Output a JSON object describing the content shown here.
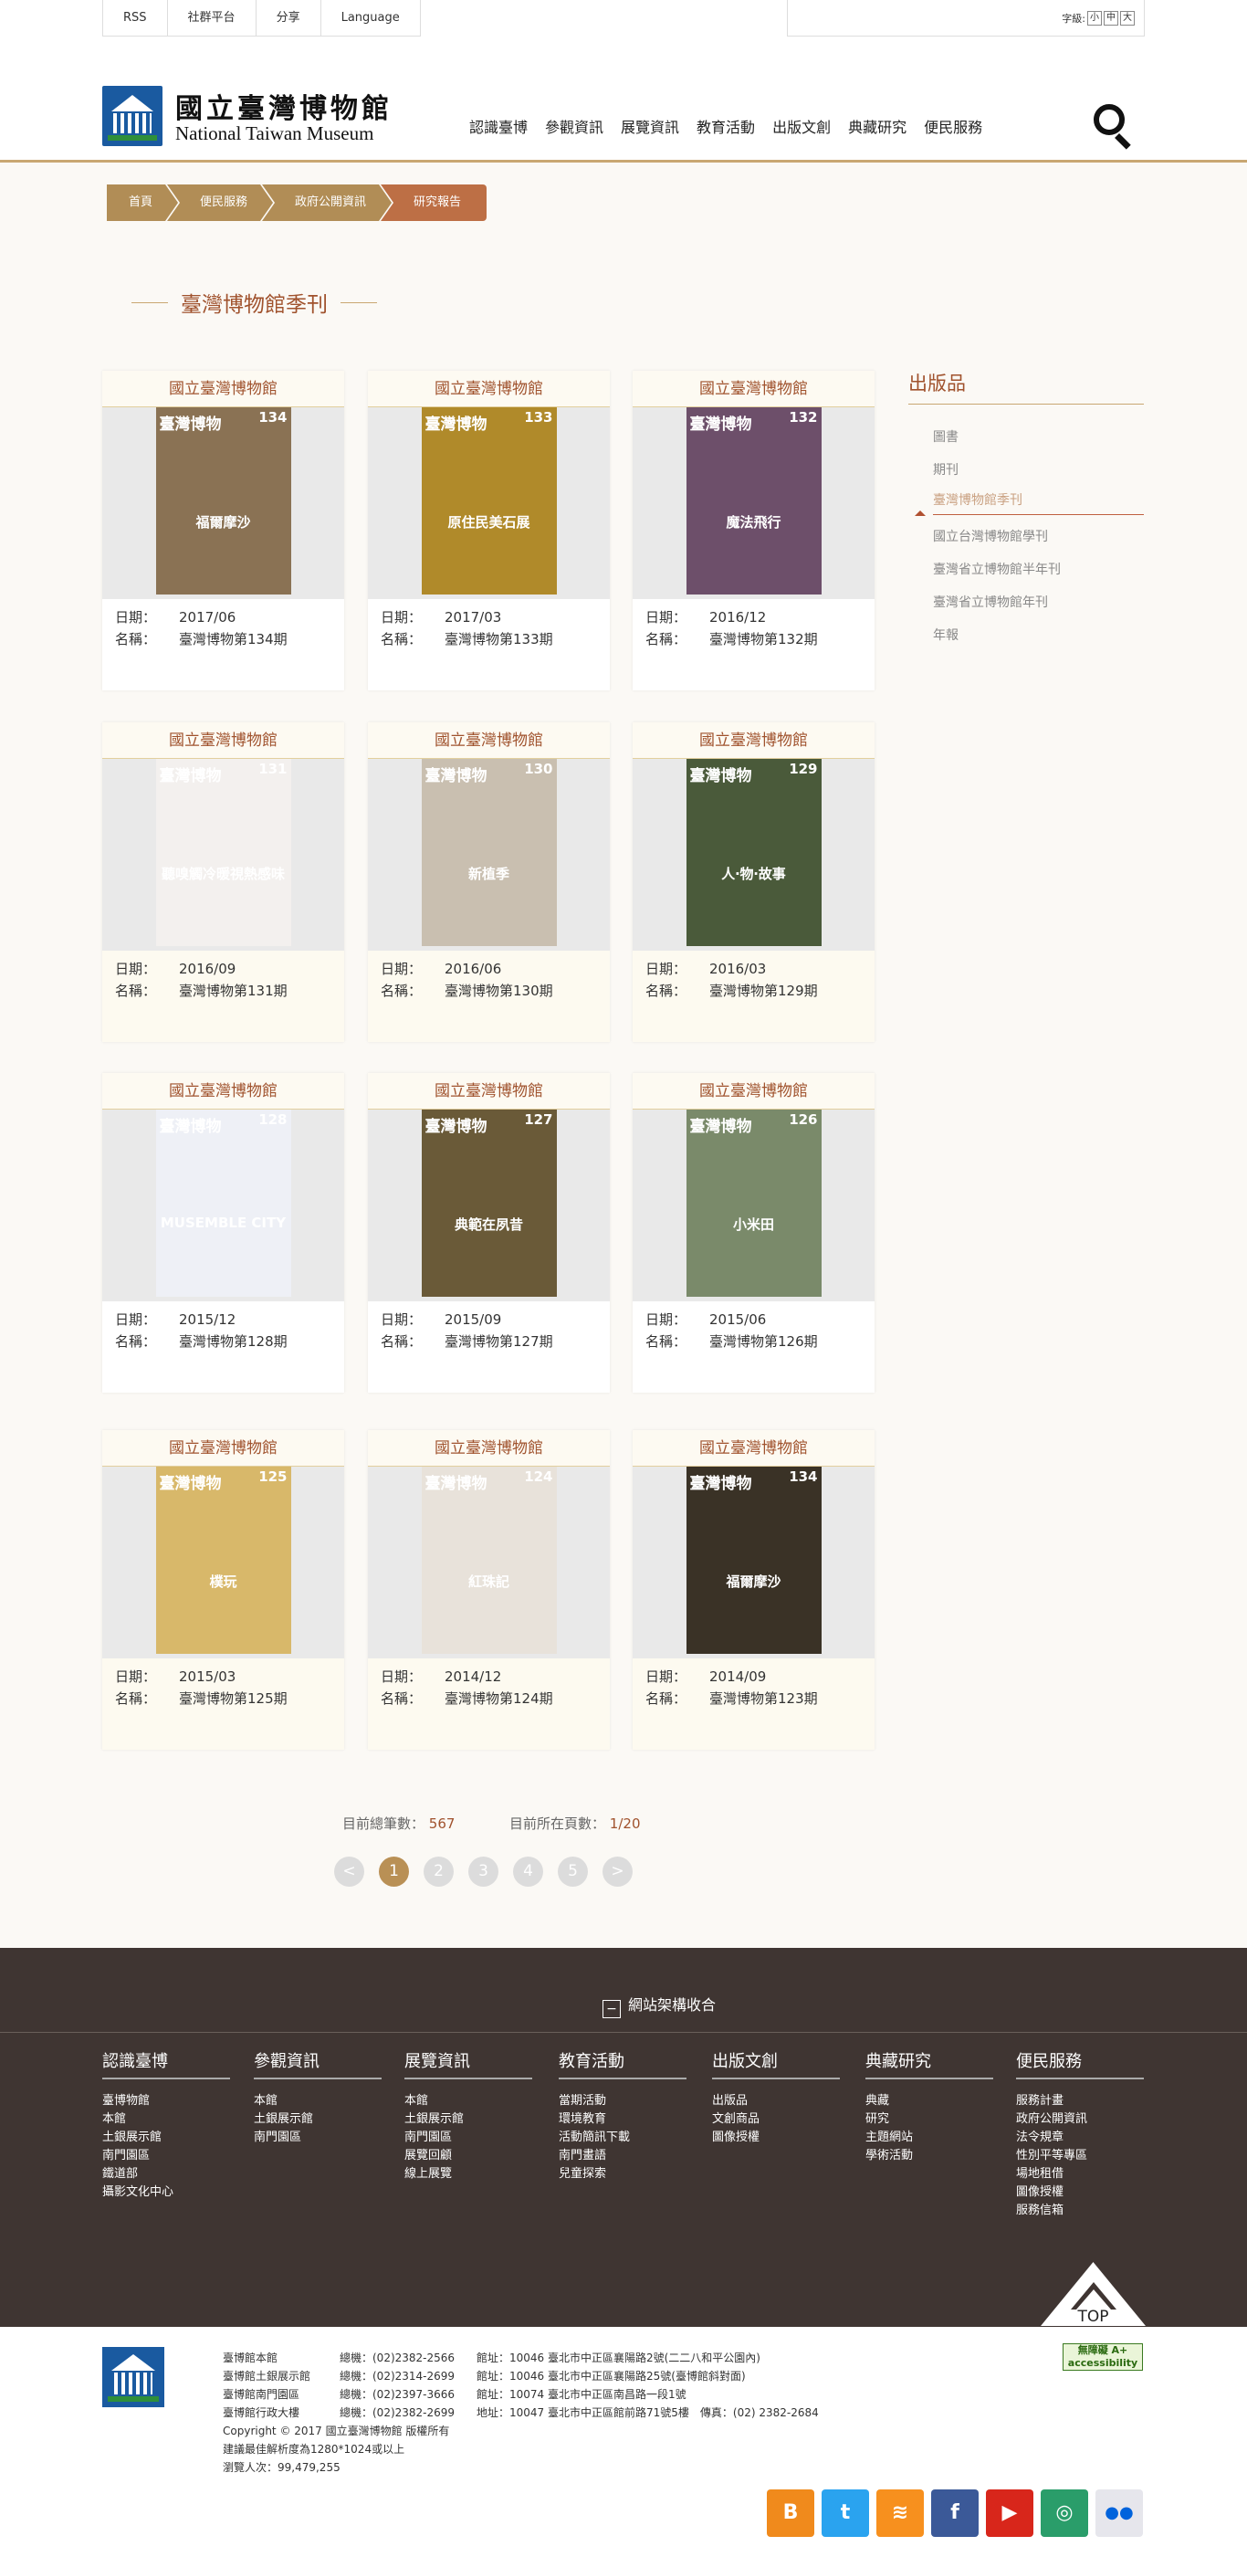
{
  "topbar": {
    "links": [
      "RSS",
      "社群平台",
      "分享",
      "Language"
    ],
    "fontsize_label": "字級:",
    "sizes": [
      "小",
      "中",
      "大"
    ]
  },
  "logo": {
    "zh": "國立臺灣博物館",
    "en": "National Taiwan Museum"
  },
  "nav": [
    "認識臺博",
    "參觀資訊",
    "展覽資訊",
    "教育活動",
    "出版文創",
    "典藏研究",
    "便民服務"
  ],
  "breadcrumb": [
    "首頁",
    "便民服務",
    "政府公開資訊",
    "研究報告"
  ],
  "page_title": "臺灣博物館季刊",
  "cards": [
    {
      "title": "國立臺灣博物館",
      "no": "134",
      "date": "2017/06",
      "name": "臺灣博物第134期",
      "bg": "#8a7254",
      "sub": "福爾摩沙"
    },
    {
      "title": "國立臺灣博物館",
      "no": "133",
      "date": "2017/03",
      "name": "臺灣博物第133期",
      "bg": "#b08a2a",
      "sub": "原住民美石展"
    },
    {
      "title": "國立臺灣博物館",
      "no": "132",
      "date": "2016/12",
      "name": "臺灣博物第132期",
      "bg": "#6d4f6a",
      "sub": "魔法飛行"
    },
    {
      "title": "國立臺灣博物館",
      "no": "131",
      "date": "2016/09",
      "name": "臺灣博物第131期",
      "bg": "#f3f0ee",
      "sub": "聽嗅觸冷暖視熱感味"
    },
    {
      "title": "國立臺灣博物館",
      "no": "130",
      "date": "2016/06",
      "name": "臺灣博物第130期",
      "bg": "#c9bfb0",
      "sub": "新植季"
    },
    {
      "title": "國立臺灣博物館",
      "no": "129",
      "date": "2016/03",
      "name": "臺灣博物第129期",
      "bg": "#4a5a3a",
      "sub": "人‧物‧故事"
    },
    {
      "title": "國立臺灣博物館",
      "no": "128",
      "date": "2015/12",
      "name": "臺灣博物第128期",
      "bg": "#eef0f6",
      "sub": "MUSEMBLE CITY"
    },
    {
      "title": "國立臺灣博物館",
      "no": "127",
      "date": "2015/09",
      "name": "臺灣博物第127期",
      "bg": "#6a5a38",
      "sub": "典範在夙昔"
    },
    {
      "title": "國立臺灣博物館",
      "no": "126",
      "date": "2015/06",
      "name": "臺灣博物第126期",
      "bg": "#7a8a6a",
      "sub": "小米田"
    },
    {
      "title": "國立臺灣博物館",
      "no": "125",
      "date": "2015/03",
      "name": "臺灣博物第125期",
      "bg": "#d8b86a",
      "sub": "樸玩"
    },
    {
      "title": "國立臺灣博物館",
      "no": "124",
      "date": "2014/12",
      "name": "臺灣博物第124期",
      "bg": "#e8e2da",
      "sub": "紅珠記"
    },
    {
      "title": "國立臺灣博物館",
      "no": "134",
      "date": "2014/09",
      "name": "臺灣博物第123期",
      "bg": "#3a3226",
      "sub": "福爾摩沙"
    }
  ],
  "meta_labels": {
    "date": "日期：",
    "name": "名稱："
  },
  "sidebar": {
    "title": "出版品",
    "items": [
      "圖書",
      "期刊",
      "臺灣博物館季刊",
      "國立台灣博物館學刊",
      "臺灣省立博物館半年刊",
      "臺灣省立博物館年刊",
      "年報"
    ]
  },
  "stats": {
    "total_label": "目前總筆數：",
    "total": "567",
    "page_label": "目前所在頁數：",
    "page": "1/20"
  },
  "pager": [
    "<",
    "1",
    "2",
    "3",
    "4",
    "5",
    ">"
  ],
  "footer": {
    "toggle": "網站架構收合",
    "columns": [
      {
        "title": "認識臺博",
        "items": [
          "臺博物館",
          "本館",
          "土銀展示館",
          "南門園區",
          "鐵道部",
          "攝影文化中心"
        ]
      },
      {
        "title": "參觀資訊",
        "items": [
          "本館",
          "土銀展示館",
          "南門園區"
        ]
      },
      {
        "title": "展覽資訊",
        "items": [
          "本館",
          "土銀展示館",
          "南門園區",
          "展覽回顧",
          "線上展覽"
        ]
      },
      {
        "title": "教育活動",
        "items": [
          "當期活動",
          "環境教育",
          "活動簡訊下載",
          "南門畫語",
          "兒童探索"
        ]
      },
      {
        "title": "出版文創",
        "items": [
          "出版品",
          "文創商品",
          "圖像授權"
        ]
      },
      {
        "title": "典藏研究",
        "items": [
          "典藏",
          "研究",
          "主題網站",
          "學術活動"
        ]
      },
      {
        "title": "便民服務",
        "items": [
          "服務計畫",
          "政府公開資訊",
          "法令規章",
          "性別平等專區",
          "場地租借",
          "圖像授權",
          "服務信箱"
        ]
      }
    ],
    "top": "TOP"
  },
  "bottom": {
    "rows": [
      [
        "臺博館本館",
        "總機：(02)2382-2566",
        "館址：10046 臺北市中正區襄陽路2號(二二八和平公園內)"
      ],
      [
        "臺博館土銀展示館",
        "總機：(02)2314-2699",
        "館址：10046 臺北市中正區襄陽路25號(臺博館斜對面)"
      ],
      [
        "臺博館南門園區",
        "總機：(02)2397-3666",
        "館址：10074 臺北市中正區南昌路一段1號"
      ],
      [
        "臺博館行政大樓",
        "總機：(02)2382-2699",
        "地址：10047 臺北市中正區館前路71號5樓　傳真：(02) 2382-2684"
      ]
    ],
    "copyright": "Copyright © 2017 國立臺灣博物館 版權所有",
    "resolution": "建議最佳解析度為1280*1024或以上",
    "visitors": "瀏覽人次：99,479,255",
    "accessibility": "無障礙 A+ accessibility",
    "social": [
      {
        "name": "blogger",
        "glyph": "B",
        "color": "#f08a1c"
      },
      {
        "name": "twitter",
        "glyph": "t",
        "color": "#2aa3ef"
      },
      {
        "name": "rss",
        "glyph": "≋",
        "color": "#f7901e"
      },
      {
        "name": "facebook",
        "glyph": "f",
        "color": "#3b5998"
      },
      {
        "name": "youtube",
        "glyph": "▶",
        "color": "#d8261b"
      },
      {
        "name": "tripadvisor",
        "glyph": "◎",
        "color": "#2a9d6a"
      },
      {
        "name": "flickr",
        "glyph": "●●",
        "color": "#e6e6ec"
      }
    ]
  }
}
